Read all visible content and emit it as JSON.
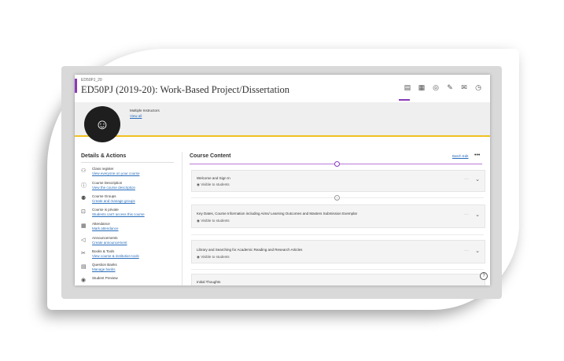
{
  "course": {
    "id": "ED50PJ_20",
    "title": "ED50PJ (2019-20): Work-Based Project/Dissertation"
  },
  "nav_icons": [
    "content-icon",
    "calendar-icon",
    "discussions-icon",
    "gradebook-icon",
    "messages-icon",
    "analytics-icon"
  ],
  "banner": {
    "instructors": "Multiple Instructors",
    "view_all": "View all"
  },
  "details": {
    "heading": "Details & Actions",
    "items": [
      {
        "icon": "people-icon",
        "title": "Class register",
        "link": "View everyone on your course"
      },
      {
        "icon": "info-icon",
        "title": "Course Description",
        "link": "View the course description"
      },
      {
        "icon": "groups-icon",
        "title": "Course Groups",
        "link": "Create and manage groups"
      },
      {
        "icon": "lock-icon",
        "title": "Course is private",
        "link": "Students can't access this course"
      },
      {
        "icon": "attendance-icon",
        "title": "Attendance",
        "link": "Mark attendance"
      },
      {
        "icon": "megaphone-icon",
        "title": "Announcements",
        "link": "Create announcement"
      },
      {
        "icon": "tools-icon",
        "title": "Books & Tools",
        "link": "View course & institution tools"
      },
      {
        "icon": "question-bank-icon",
        "title": "Question Banks",
        "link": "Manage banks"
      },
      {
        "icon": "preview-icon",
        "title": "Student Preview",
        "link": ""
      }
    ]
  },
  "content": {
    "heading": "Course Content",
    "batch_edit": "Batch Edit",
    "more": "•••",
    "items": [
      {
        "title": "Welcome and Sign In",
        "visibility": "Visible to students"
      },
      {
        "title": "Key Dates, Course Information including Aims/ Learning Outcomes and Masters Submission Exemplar",
        "visibility": "Visible to students"
      },
      {
        "title": "Library and Searching for Academic Reading and Research Articles",
        "visibility": "Visible to students"
      },
      {
        "title": "Initial Thoughts",
        "visibility": ""
      }
    ]
  },
  "help": "?"
}
